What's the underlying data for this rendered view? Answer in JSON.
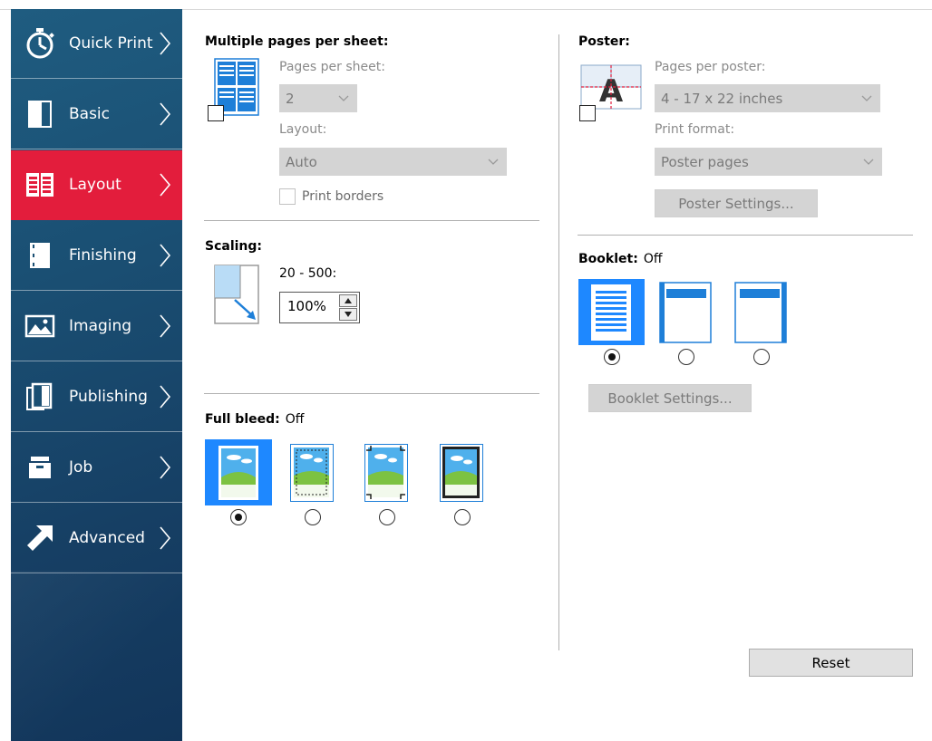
{
  "sidebar": {
    "items": [
      {
        "label": "Quick Print",
        "icon": "stopwatch-icon"
      },
      {
        "label": "Basic",
        "icon": "book-icon"
      },
      {
        "label": "Layout",
        "icon": "layout-icon",
        "active": true
      },
      {
        "label": "Finishing",
        "icon": "finishing-icon"
      },
      {
        "label": "Imaging",
        "icon": "image-icon"
      },
      {
        "label": "Publishing",
        "icon": "publishing-icon"
      },
      {
        "label": "Job",
        "icon": "job-tray-icon"
      },
      {
        "label": "Advanced",
        "icon": "arrow-up-right-icon"
      }
    ],
    "active_color": "#e31d3c"
  },
  "multiple_pages": {
    "title": "Multiple pages per sheet:",
    "pages_label": "Pages per sheet:",
    "pages_value": "2",
    "layout_label": "Layout:",
    "layout_value": "Auto",
    "borders_label": "Print borders"
  },
  "scaling": {
    "title": "Scaling:",
    "range_label": "20 - 500:",
    "value": "100%"
  },
  "full_bleed": {
    "title": "Full bleed:",
    "value": "Off",
    "selected_index": 0
  },
  "poster": {
    "title": "Poster:",
    "pages_label": "Pages per poster:",
    "pages_value": "4 - 17 x 22 inches",
    "format_label": "Print format:",
    "format_value": "Poster pages",
    "settings_button": "Poster Settings..."
  },
  "booklet": {
    "title": "Booklet:",
    "value": "Off",
    "selected_index": 0,
    "settings_button": "Booklet Settings..."
  },
  "reset_button": "Reset",
  "accent_color": "#1e88ff"
}
